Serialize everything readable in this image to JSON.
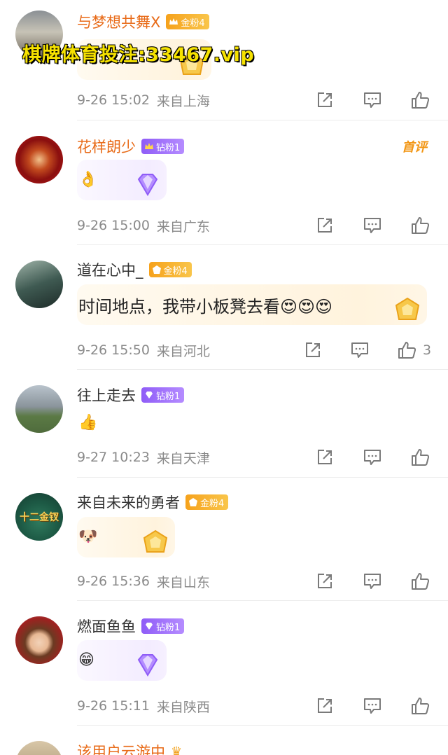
{
  "watermark": "棋牌体育投注:33467.vip",
  "hot_tag": "首评",
  "comments": [
    {
      "username": "与梦想共舞X",
      "badge": "金粉4",
      "badge_type": "gold",
      "time": "9-26 15:02",
      "source": "来自上海",
      "text": "",
      "likes": ""
    },
    {
      "username": "花样朗少",
      "badge": "钻粉1",
      "badge_type": "diamond",
      "time": "9-26 15:00",
      "source": "来自广东",
      "text": "👌",
      "likes": ""
    },
    {
      "username": "道在心中_",
      "badge": "金粉4",
      "badge_type": "gold",
      "time": "9-26 15:50",
      "source": "来自河北",
      "text": "时间地点，我带小板凳去看😍😍😍",
      "likes": "3"
    },
    {
      "username": "往上走去",
      "badge": "钻粉1",
      "badge_type": "diamond",
      "time": "9-27 10:23",
      "source": "来自天津",
      "text": "👍",
      "likes": ""
    },
    {
      "username": "来自未来的勇者",
      "badge": "金粉4",
      "badge_type": "gold",
      "time": "9-26 15:36",
      "source": "来自山东",
      "text": "🐶",
      "likes": ""
    },
    {
      "username": "燃面鱼鱼",
      "badge": "钻粉1",
      "badge_type": "diamond",
      "time": "9-26 15:11",
      "source": "来自陕西",
      "text": "😁",
      "likes": ""
    },
    {
      "username": "该用户云游中",
      "badge": "",
      "badge_type": "gold",
      "time": "",
      "source": "",
      "text": "",
      "likes": ""
    }
  ],
  "avatar_labels": {
    "c5": "十二金钗"
  },
  "colors": {
    "gold_badge": "#f6a21c",
    "diamond_badge": "#8f5cf7",
    "username_orange": "#e86a17",
    "meta_gray": "#8a8a8a"
  },
  "icons": [
    "share-icon",
    "comment-icon",
    "like-icon"
  ]
}
